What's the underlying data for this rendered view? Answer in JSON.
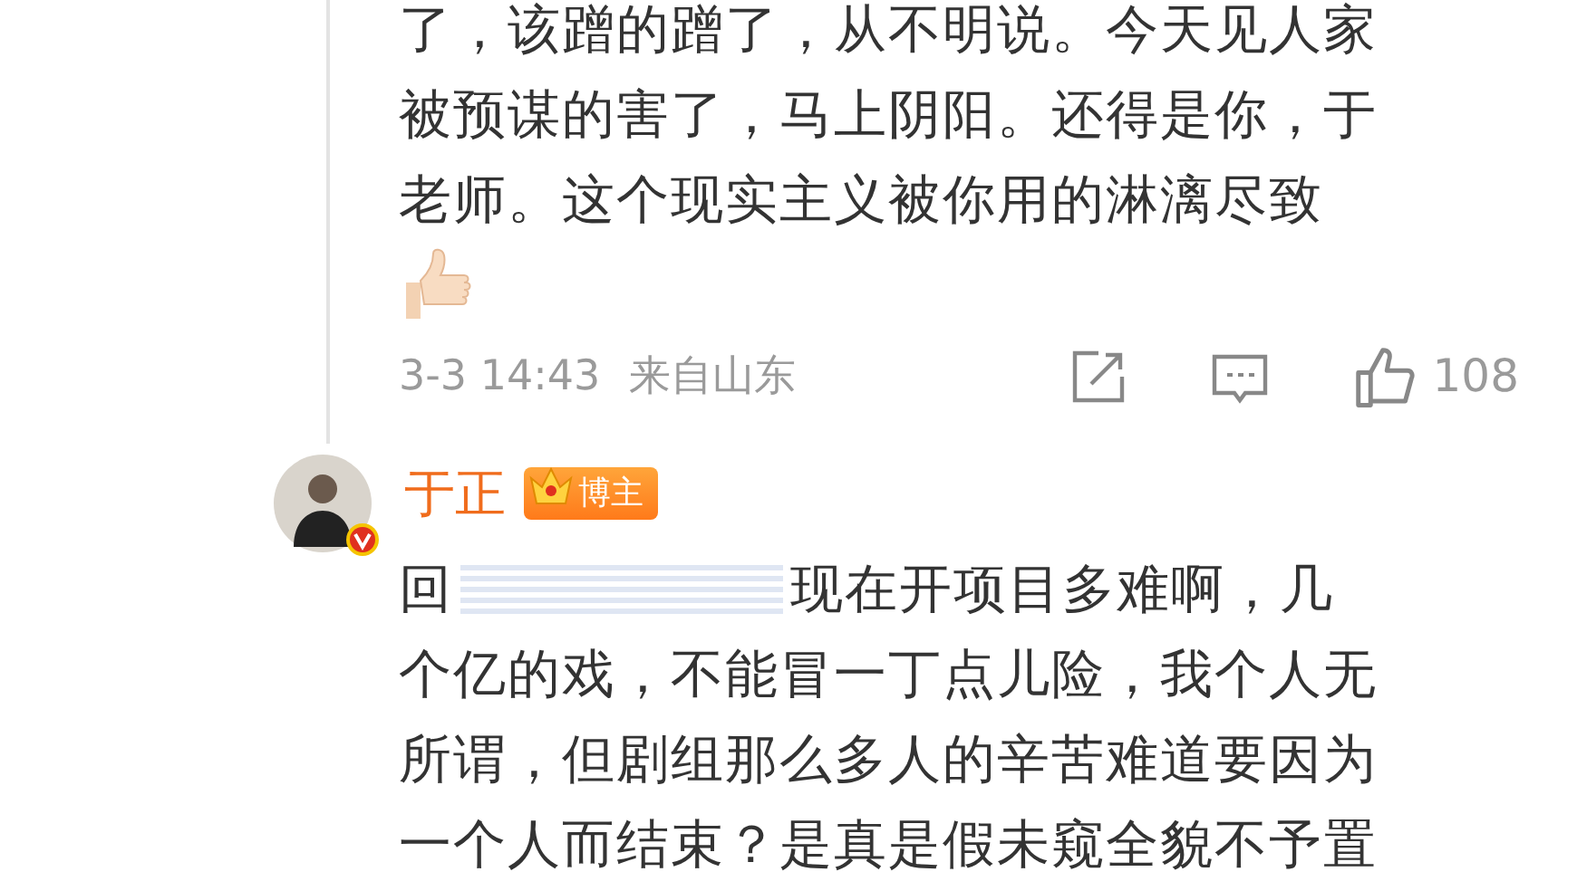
{
  "comment": {
    "lines": [
      "了，该蹭的蹭了，从不明说。今天见人家",
      "被预谋的害了，马上阴阳。还得是你，于",
      "老师。这个现实主义被你用的淋漓尽致"
    ],
    "time": "3-3 14:43",
    "location": "来自山东",
    "likes": "108"
  },
  "reply": {
    "author": "于正",
    "badge": "博主",
    "verified": true,
    "lines": [
      {
        "kind": "start",
        "text": "回"
      },
      {
        "kind": "rest",
        "text": "现在开项目多难啊，几"
      },
      {
        "kind": "line",
        "text": "个亿的戏，不能冒一丁点儿险，我个人无"
      },
      {
        "kind": "line",
        "text": "所谓，但剧组那么多人的辛苦难道要因为"
      },
      {
        "kind": "line",
        "text": "一个人而结束？是真是假未窥全貌不予置"
      }
    ]
  }
}
